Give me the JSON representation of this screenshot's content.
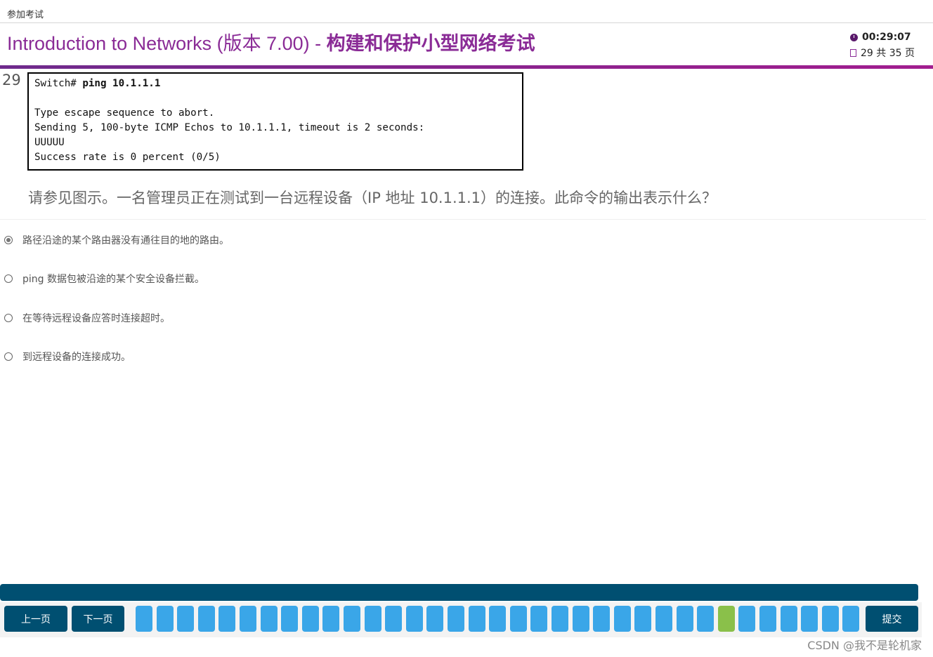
{
  "window": {
    "title": "参加考试"
  },
  "header": {
    "exam_title_prefix": "Introduction to Networks (版本 7.00) - ",
    "exam_title_main": "构建和保护小型网络考试",
    "timer": "00:29:07",
    "page_indicator": "29 共 35 页",
    "icons": {
      "timer": "clock-icon",
      "page": "page-icon"
    },
    "accent_color": "#8a2b96"
  },
  "question": {
    "number": "29",
    "exhibit_lines": [
      {
        "prompt": "Switch# ",
        "command": "ping 10.1.1.1"
      },
      {
        "text": ""
      },
      {
        "text": "Type escape sequence to abort."
      },
      {
        "text": "Sending 5, 100-byte ICMP Echos to 10.1.1.1, timeout is 2 seconds:"
      },
      {
        "text": "UUUUU"
      },
      {
        "text": "Success rate is 0 percent (0/5)"
      }
    ],
    "text": "请参见图示。一名管理员正在测试到一台远程设备（IP 地址 10.1.1.1）的连接。此命令的输出表示什么？",
    "options": [
      {
        "label": "路径沿途的某个路由器没有通往目的地的路由。",
        "selected": true
      },
      {
        "label": "ping 数据包被沿途的某个安全设备拦截。",
        "selected": false
      },
      {
        "label": "在等待远程设备应答时连接超时。",
        "selected": false
      },
      {
        "label": "到远程设备的连接成功。",
        "selected": false
      }
    ]
  },
  "navigation": {
    "prev_label": "上一页",
    "next_label": "下一页",
    "submit_label": "提交",
    "total_pages": 35,
    "current_page": 29,
    "colors": {
      "button": "#004f71",
      "page": "#3aa6e8",
      "current": "#8ac04a"
    }
  },
  "watermark": "CSDN @我不是轮机家"
}
